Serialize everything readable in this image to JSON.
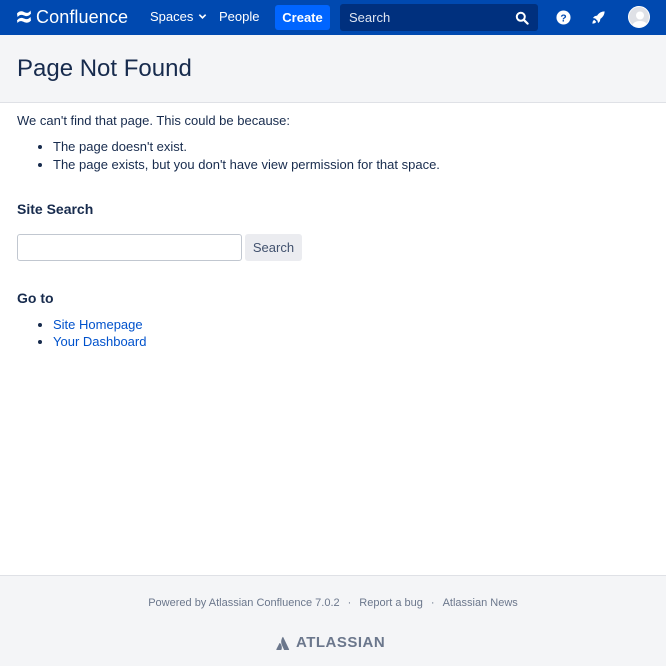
{
  "header": {
    "logo_text": "Confluence",
    "nav_spaces": "Spaces",
    "nav_people": "People",
    "create_label": "Create",
    "search_placeholder": "Search"
  },
  "page": {
    "title": "Page Not Found",
    "intro": "We can't find that page. This could be because:",
    "reasons": [
      "The page doesn't exist.",
      "The page exists, but you don't have view permission for that space."
    ]
  },
  "site_search": {
    "heading": "Site Search",
    "input_value": "",
    "button_label": "Search"
  },
  "goto": {
    "heading": "Go to",
    "links": [
      "Site Homepage",
      "Your Dashboard"
    ]
  },
  "footer": {
    "powered_by": "Powered by Atlassian Confluence 7.0.2",
    "report_bug": "Report a bug",
    "news": "Atlassian News",
    "separator": "·",
    "brand": "ATLASSIAN"
  },
  "colors": {
    "header_bg": "#0049b0",
    "create_bg": "#0065ff",
    "link": "#0052cc",
    "text": "#172b4d"
  },
  "icons": [
    "confluence-logo-icon",
    "chevron-down-icon",
    "search-icon",
    "help-icon",
    "notifications-icon",
    "user-avatar-icon",
    "atlassian-logo-icon"
  ]
}
